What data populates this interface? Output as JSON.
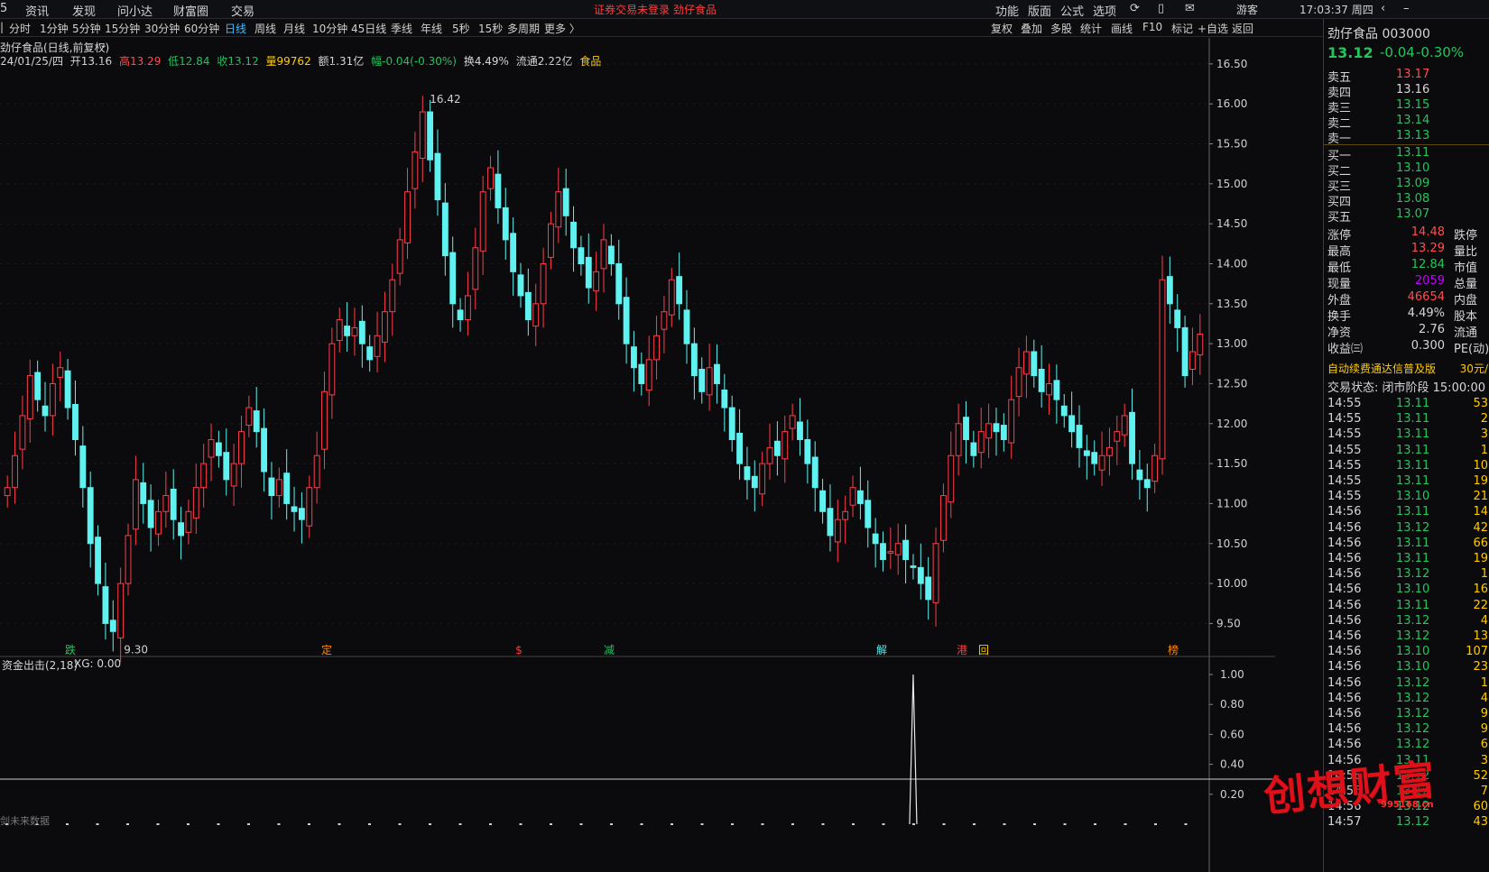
{
  "menubar": {
    "left": [
      "资讯",
      "发现",
      "问小达",
      "财富圈",
      "交易"
    ],
    "notice": "证券交易未登录",
    "stock_name": "劲仔食品",
    "right": [
      "功能",
      "版面",
      "公式",
      "选项"
    ],
    "user": "游客",
    "clock": "17:03:37 周四"
  },
  "toolbar": {
    "periods": [
      "分时",
      "1分钟",
      "5分钟",
      "15分钟",
      "30分钟",
      "60分钟",
      "日线",
      "周线",
      "月线",
      "10分钟",
      "45日线",
      "季线",
      "年线",
      "5秒",
      "15秒",
      "多周期",
      "更多 〉"
    ],
    "active": "日线",
    "right": [
      "复权",
      "叠加",
      "多股",
      "统计",
      "画线",
      "F10",
      "标记",
      "+自选",
      "返回"
    ]
  },
  "chart": {
    "title": "劲仔食品(日线,前复权)",
    "info": {
      "date": "24/01/25/四",
      "open": "开13.16",
      "high": "高13.29",
      "low": "低12.84",
      "close": "收13.12",
      "vol": "量99762",
      "amt": "额1.31亿",
      "chg": "幅-0.04(-0.30%)",
      "turn": "换4.49%",
      "float": "流通2.22亿",
      "sector": "食品"
    },
    "max_label": "16.42",
    "min_label": "9.30",
    "events": [
      "跌",
      "定",
      "$",
      "减",
      "解",
      "港",
      "回",
      "榜"
    ],
    "indicator_title": "资金出击(2,18)",
    "indicator_value": "XG: 0.00",
    "no_data": "剑未来数据",
    "colors": {
      "up": "#ff3d4a",
      "down": "#5ff2f0",
      "axis": "#d0d0d0"
    }
  },
  "chart_data": {
    "type": "candlestick",
    "y_ticks": [
      "16.50",
      "16.00",
      "15.50",
      "15.00",
      "14.50",
      "14.00",
      "13.50",
      "13.00",
      "12.50",
      "12.00",
      "11.50",
      "11.00",
      "10.50",
      "10.00",
      "9.50"
    ],
    "ylim": [
      9.2,
      16.6
    ],
    "closes": [
      11.2,
      11.6,
      12.1,
      12.6,
      12.3,
      12.1,
      12.5,
      12.7,
      12.2,
      11.8,
      11.2,
      10.5,
      10.0,
      9.5,
      9.4,
      10.0,
      10.6,
      11.3,
      11.0,
      10.7,
      10.9,
      11.1,
      10.8,
      10.6,
      10.9,
      11.2,
      11.5,
      11.8,
      11.6,
      11.3,
      11.5,
      11.9,
      12.2,
      11.9,
      11.4,
      11.1,
      11.3,
      11.0,
      10.9,
      10.8,
      11.2,
      11.6,
      12.4,
      13.0,
      13.3,
      13.1,
      13.2,
      13.0,
      12.8,
      13.1,
      13.4,
      13.8,
      14.3,
      14.9,
      15.4,
      15.9,
      15.3,
      14.8,
      14.1,
      13.5,
      13.3,
      13.6,
      14.2,
      14.9,
      15.2,
      14.7,
      14.3,
      13.9,
      13.6,
      13.3,
      13.5,
      14.0,
      14.5,
      14.9,
      14.6,
      14.2,
      14.0,
      13.7,
      13.9,
      14.3,
      14.0,
      13.5,
      13.0,
      12.7,
      12.5,
      12.8,
      13.1,
      13.4,
      13.8,
      13.5,
      13.0,
      12.6,
      12.4,
      12.7,
      12.5,
      12.2,
      11.8,
      11.5,
      11.3,
      11.2,
      11.5,
      11.7,
      11.6,
      11.9,
      12.1,
      11.8,
      11.5,
      11.2,
      10.9,
      10.6,
      10.8,
      10.9,
      11.2,
      11.0,
      10.7,
      10.5,
      10.3,
      10.4,
      10.5,
      10.3,
      10.2,
      10.0,
      9.8,
      10.5,
      11.1,
      11.6,
      12.0,
      11.8,
      11.6,
      11.9,
      12.0,
      11.9,
      11.8,
      12.3,
      12.7,
      12.9,
      12.6,
      12.4,
      12.5,
      12.3,
      12.1,
      11.9,
      11.7,
      11.6,
      11.5,
      11.6,
      11.7,
      11.9,
      12.1,
      11.5,
      11.3,
      11.2,
      11.6,
      13.8,
      13.5,
      13.2,
      12.6,
      12.9,
      13.12
    ],
    "sell": [
      {
        "label": "卖五",
        "price": "13.17"
      },
      {
        "label": "卖四",
        "price": "13.16"
      },
      {
        "label": "卖三",
        "price": "13.15"
      },
      {
        "label": "卖二",
        "price": "13.14"
      },
      {
        "label": "卖一",
        "price": "13.13"
      }
    ],
    "buy": [
      {
        "label": "买一",
        "price": "13.11"
      },
      {
        "label": "买二",
        "price": "13.10"
      },
      {
        "label": "买三",
        "price": "13.09"
      },
      {
        "label": "买四",
        "price": "13.08"
      },
      {
        "label": "买五",
        "price": "13.07"
      }
    ],
    "indicator_ticks": [
      "1.00",
      "0.80",
      "0.60",
      "0.40",
      "0.20"
    ],
    "indicator_spike_index": 120
  },
  "quote": {
    "name": "劲仔食品 003000",
    "price": "13.12",
    "chg": "-0.04",
    "pct": "-0.30%",
    "stats": [
      {
        "a": "涨停",
        "v": "14.48",
        "vc": "r",
        "b": "跌停"
      },
      {
        "a": "最高",
        "v": "13.29",
        "vc": "r",
        "b": "量比"
      },
      {
        "a": "最低",
        "v": "12.84",
        "vc": "g",
        "b": "市值"
      },
      {
        "a": "现量",
        "v": "2059",
        "vc": "p",
        "b": "总量"
      },
      {
        "a": "外盘",
        "v": "46654",
        "vc": "r",
        "b": "内盘"
      },
      {
        "a": "换手",
        "v": "4.49%",
        "vc": "w",
        "b": "股本"
      },
      {
        "a": "净资",
        "v": "2.76",
        "vc": "w",
        "b": "流通"
      },
      {
        "a": "收益㈢",
        "v": "0.300",
        "vc": "w",
        "b": "PE(动)"
      }
    ],
    "ad": "自动续费通达信普及版",
    "ad_price": "30元/",
    "status": "交易状态: 闭市阶段 15:00:00",
    "ticks": [
      {
        "t": "14:55",
        "p": "13.11",
        "v": "53"
      },
      {
        "t": "14:55",
        "p": "13.11",
        "v": "2"
      },
      {
        "t": "14:55",
        "p": "13.11",
        "v": "3"
      },
      {
        "t": "14:55",
        "p": "13.11",
        "v": "1"
      },
      {
        "t": "14:55",
        "p": "13.11",
        "v": "10"
      },
      {
        "t": "14:55",
        "p": "13.11",
        "v": "19"
      },
      {
        "t": "14:55",
        "p": "13.10",
        "v": "21"
      },
      {
        "t": "14:56",
        "p": "13.11",
        "v": "14"
      },
      {
        "t": "14:56",
        "p": "13.12",
        "v": "42"
      },
      {
        "t": "14:56",
        "p": "13.11",
        "v": "66"
      },
      {
        "t": "14:56",
        "p": "13.11",
        "v": "19"
      },
      {
        "t": "14:56",
        "p": "13.12",
        "v": "1"
      },
      {
        "t": "14:56",
        "p": "13.10",
        "v": "16"
      },
      {
        "t": "14:56",
        "p": "13.11",
        "v": "22"
      },
      {
        "t": "14:56",
        "p": "13.12",
        "v": "4"
      },
      {
        "t": "14:56",
        "p": "13.12",
        "v": "13"
      },
      {
        "t": "14:56",
        "p": "13.10",
        "v": "107"
      },
      {
        "t": "14:56",
        "p": "13.10",
        "v": "23"
      },
      {
        "t": "14:56",
        "p": "13.12",
        "v": "1"
      },
      {
        "t": "14:56",
        "p": "13.12",
        "v": "4"
      },
      {
        "t": "14:56",
        "p": "13.12",
        "v": "9"
      },
      {
        "t": "14:56",
        "p": "13.12",
        "v": "9"
      },
      {
        "t": "14:56",
        "p": "13.12",
        "v": "6"
      },
      {
        "t": "14:56",
        "p": "13.11",
        "v": "3"
      },
      {
        "t": "14:56",
        "p": "13.12",
        "v": "52"
      },
      {
        "t": "14:56",
        "p": "13.12",
        "v": "7"
      },
      {
        "t": "14:56",
        "p": "13.12",
        "v": "60"
      },
      {
        "t": "14:57",
        "p": "13.12",
        "v": "43"
      }
    ]
  },
  "watermark": {
    "text": "创想财富",
    "url": "995168.cn"
  }
}
